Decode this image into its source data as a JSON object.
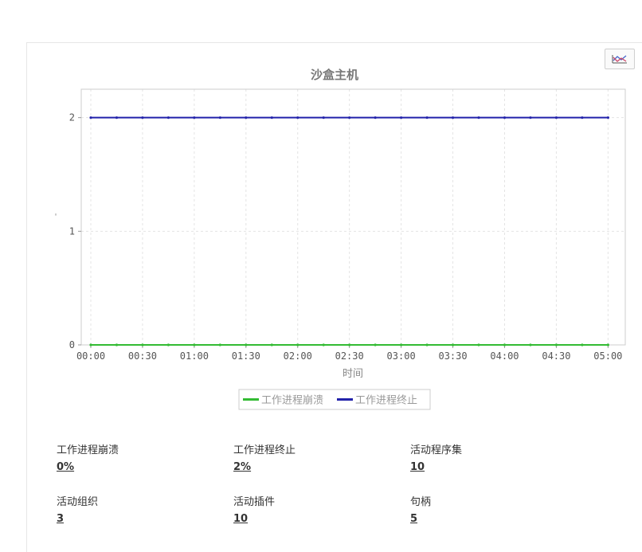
{
  "chart_data": {
    "type": "line",
    "title": "沙盒主机",
    "xlabel": "时间",
    "ylabel": "'",
    "x_ticks": [
      "00:00",
      "00:30",
      "01:00",
      "01:30",
      "02:00",
      "02:30",
      "03:00",
      "03:30",
      "04:00",
      "04:30",
      "05:00"
    ],
    "y_ticks": [
      "0",
      "1",
      "2"
    ],
    "xlim": [
      0,
      310
    ],
    "ylim": [
      0,
      2.25
    ],
    "x_unit_minutes": true,
    "x": [
      0,
      15,
      30,
      45,
      60,
      75,
      90,
      105,
      120,
      135,
      150,
      165,
      180,
      195,
      210,
      225,
      240,
      255,
      270,
      285,
      300
    ],
    "series": [
      {
        "name": "工作进程崩溃",
        "color": "#33bb33",
        "values": [
          0,
          0,
          0,
          0,
          0,
          0,
          0,
          0,
          0,
          0,
          0,
          0,
          0,
          0,
          0,
          0,
          0,
          0,
          0,
          0,
          0
        ]
      },
      {
        "name": "工作进程终止",
        "color": "#2222aa",
        "values": [
          2,
          2,
          2,
          2,
          2,
          2,
          2,
          2,
          2,
          2,
          2,
          2,
          2,
          2,
          2,
          2,
          2,
          2,
          2,
          2,
          2
        ]
      }
    ],
    "grid": true,
    "legend_position": "bottom-center"
  },
  "stats": [
    {
      "label": "工作进程崩溃",
      "value": "0%"
    },
    {
      "label": "工作进程终止",
      "value": "2%"
    },
    {
      "label": "活动程序集",
      "value": "10"
    },
    {
      "label": "活动组织",
      "value": "3"
    },
    {
      "label": "活动插件",
      "value": "10"
    },
    {
      "label": "句柄",
      "value": "5"
    }
  ],
  "colors": {
    "grid": "#e4e4e4",
    "axis": "#cccccc",
    "tick_text": "#555555",
    "title_text": "#777777"
  },
  "icons": {
    "chart_toggle": "line-chart-icon"
  }
}
